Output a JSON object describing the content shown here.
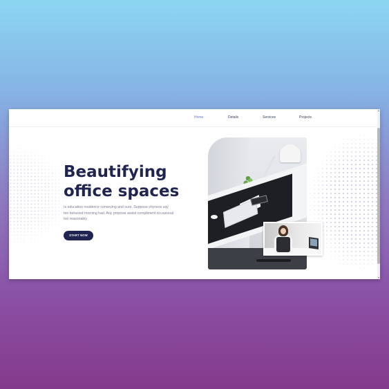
{
  "nav": {
    "items": [
      {
        "label": "Home",
        "active": true
      },
      {
        "label": "Details",
        "active": false
      },
      {
        "label": "Services",
        "active": false
      },
      {
        "label": "Projects",
        "active": false
      }
    ]
  },
  "hero": {
    "title_line1": "Beautifying",
    "title_line2": "office spaces",
    "description": "Is education residence conveying and sure. Suppose shyness say ten behaved morning had. Any propose assist compliment occasional too reasonably",
    "cta_label": "START NOW"
  },
  "colors": {
    "primary": "#1f2550",
    "accent": "#6b73d8",
    "body_text": "#7c8091",
    "background_top": "#8cd6f2",
    "background_bottom": "#843a8c"
  },
  "icons": {
    "scroll_up": "triangle-up",
    "scroll_down": "triangle-down"
  }
}
